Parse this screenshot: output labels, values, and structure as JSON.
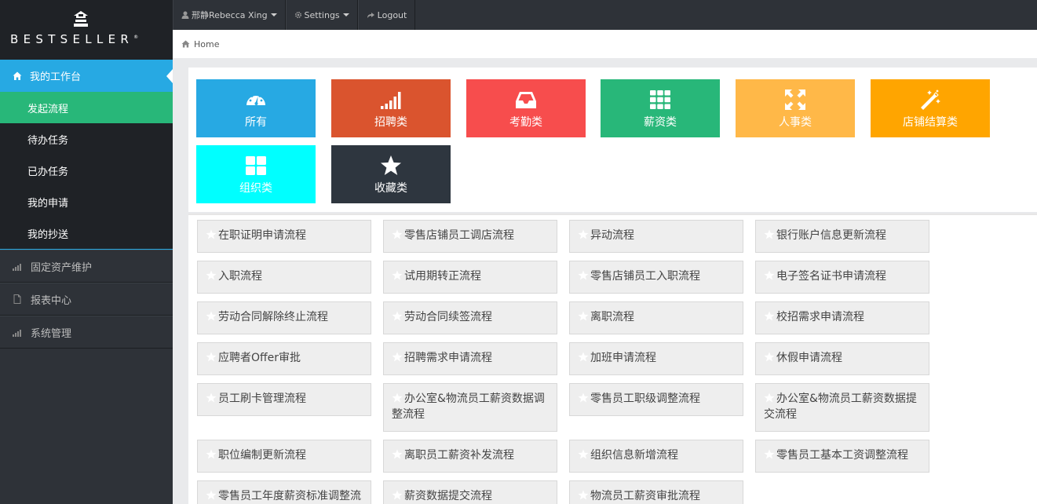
{
  "brand": {
    "logo_text": "BESTSELLER",
    "logo_mark": "®"
  },
  "topbar": {
    "user_label": "邢静Rebecca Xing",
    "settings_label": "Settings",
    "logout_label": "Logout"
  },
  "breadcrumb": {
    "home_label": "Home"
  },
  "sidebar": {
    "active_label": "我的工作台",
    "subitems": [
      "发起流程",
      "待办任务",
      "已办任务",
      "我的申请",
      "我的抄送"
    ],
    "items": [
      "固定资产维护",
      "报表中心",
      "系统管理"
    ]
  },
  "categories": [
    {
      "label": "所有",
      "color": "#27a9e3",
      "icon": "dashboard-icon"
    },
    {
      "label": "招聘类",
      "color": "#da542e",
      "icon": "signal-icon"
    },
    {
      "label": "考勤类",
      "color": "#f74d4d",
      "icon": "inbox-icon"
    },
    {
      "label": "薪资类",
      "color": "#28b779",
      "icon": "grid-icon"
    },
    {
      "label": "人事类",
      "color": "#ffb848",
      "icon": "fullscreen-icon"
    },
    {
      "label": "店铺结算类",
      "color": "#ffa500",
      "icon": "magic-wand-icon"
    },
    {
      "label": "组织类",
      "color": "#00ffff",
      "icon": "th-large-icon"
    },
    {
      "label": "收藏类",
      "color": "#2e363f",
      "icon": "star-icon"
    }
  ],
  "processes": [
    "在职证明申请流程",
    "零售店铺员工调店流程",
    "异动流程",
    "银行账户信息更新流程",
    "入职流程",
    "试用期转正流程",
    "零售店铺员工入职流程",
    "电子签名证书申请流程",
    "劳动合同解除终止流程",
    "劳动合同续签流程",
    "离职流程",
    "校招需求申请流程",
    "应聘者Offer审批",
    "招聘需求申请流程",
    "加班申请流程",
    "休假申请流程",
    "员工刷卡管理流程",
    "办公室&物流员工薪资数据调整流程",
    "零售员工职级调整流程",
    "办公室&物流员工薪资数据提交流程",
    "职位编制更新流程",
    "离职员工薪资补发流程",
    "组织信息新增流程",
    "零售员工基本工资调整流程",
    "零售员工年度薪资标准调整流",
    "薪资数据提交流程",
    "物流员工薪资审批流程"
  ]
}
